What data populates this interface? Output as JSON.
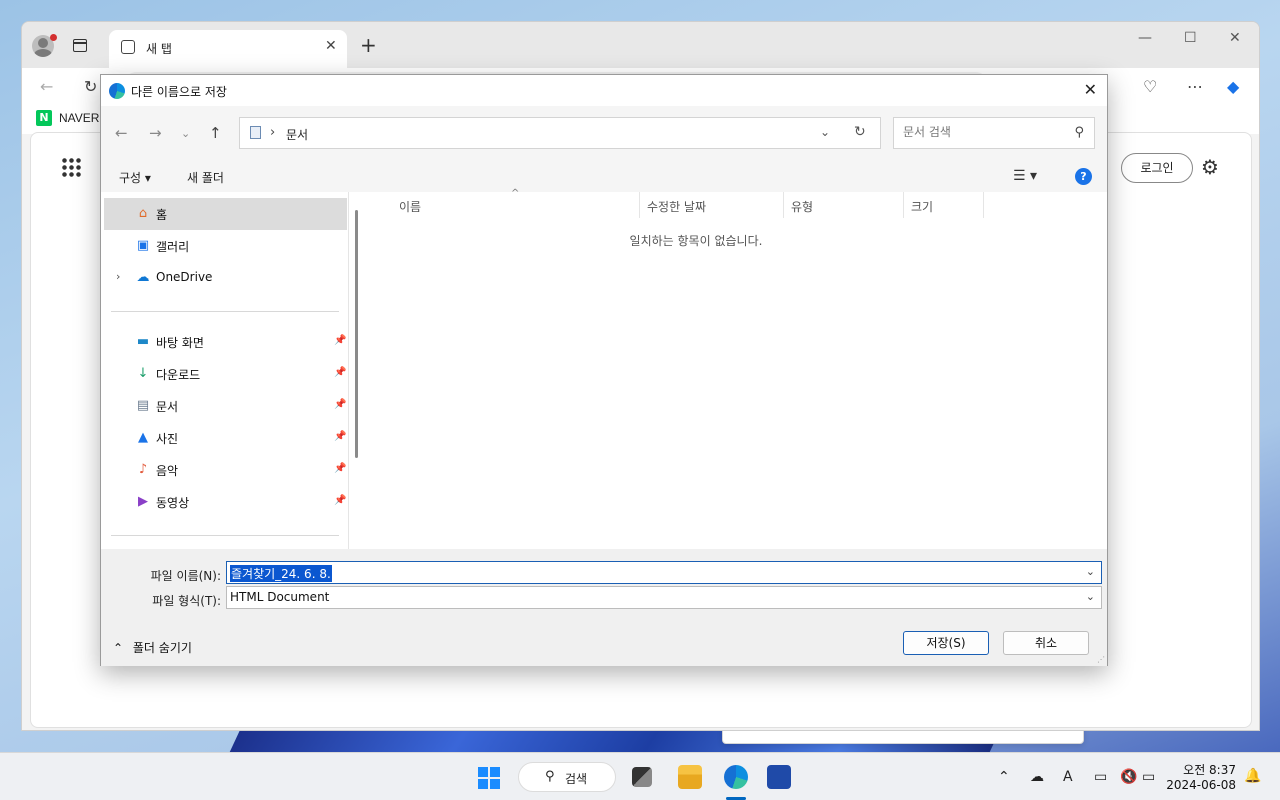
{
  "browser": {
    "tab_title": "새 탭",
    "bookmark": "NAVER",
    "login_label": "로그인",
    "naver_logo_letter": "N"
  },
  "dialog": {
    "title": "다른 이름으로 저장",
    "path": "문서",
    "search_placeholder": "문서 검색",
    "organize": "구성 ▾",
    "new_folder": "새 폴더",
    "help": "?",
    "nav_items": [
      {
        "label": "홈",
        "icon": "home-icon"
      },
      {
        "label": "갤러리",
        "icon": "gallery-icon"
      },
      {
        "label": "OneDrive",
        "icon": "onedrive-icon"
      },
      {
        "label": "바탕 화면",
        "icon": "desktop-icon"
      },
      {
        "label": "다운로드",
        "icon": "download-icon"
      },
      {
        "label": "문서",
        "icon": "documents-icon"
      },
      {
        "label": "사진",
        "icon": "pictures-icon"
      },
      {
        "label": "음악",
        "icon": "music-icon"
      },
      {
        "label": "동영상",
        "icon": "videos-icon"
      }
    ],
    "columns": [
      "이름",
      "수정한 날짜",
      "유형",
      "크기"
    ],
    "empty_message": "일치하는 항목이 없습니다.",
    "filename_label": "파일 이름(N):",
    "filename_value": "즐겨찾기_24. 6. 8.",
    "filetype_label": "파일 형식(T):",
    "filetype_value": "HTML Document",
    "hide_folders": "폴더 숨기기",
    "save_button": "저장(S)",
    "cancel_button": "취소"
  },
  "taskbar": {
    "search_label": "검색",
    "time": "오전 8:37",
    "date": "2024-06-08"
  },
  "colors": {
    "accent": "#0067c0",
    "selection": "#0b57d0",
    "help": "#1a73e8"
  }
}
